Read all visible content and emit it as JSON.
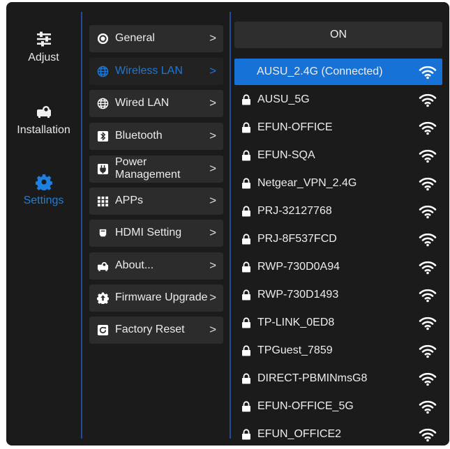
{
  "nav": [
    {
      "label": "Adjust",
      "icon": "sliders-icon"
    },
    {
      "label": "Installation",
      "icon": "projector-icon"
    },
    {
      "label": "Settings",
      "icon": "gear-icon",
      "active": true
    }
  ],
  "menu": [
    {
      "label": "General",
      "icon": "radio-circle-icon"
    },
    {
      "label": "Wireless LAN",
      "icon": "globe-icon",
      "active": true
    },
    {
      "label": "Wired LAN",
      "icon": "globe-icon"
    },
    {
      "label": "Bluetooth",
      "icon": "bluetooth-icon"
    },
    {
      "label": "Power Management",
      "line1": "Power",
      "line2": "Management",
      "icon": "power-plug-icon"
    },
    {
      "label": "APPs",
      "icon": "apps-grid-icon"
    },
    {
      "label": "HDMI Setting",
      "icon": "hdmi-icon"
    },
    {
      "label": "About...",
      "icon": "projector-icon"
    },
    {
      "label": "Firmware Upgrade",
      "icon": "upgrade-icon"
    },
    {
      "label": "Factory Reset",
      "icon": "reset-icon"
    }
  ],
  "chevron": ">",
  "wifi_toggle": "ON",
  "networks": [
    {
      "name": "AUSU_2.4G (Connected)",
      "connected": true,
      "locked": false
    },
    {
      "name": "AUSU_5G",
      "locked": true
    },
    {
      "name": "EFUN-OFFICE",
      "locked": true
    },
    {
      "name": "EFUN-SQA",
      "locked": true
    },
    {
      "name": "Netgear_VPN_2.4G",
      "locked": true
    },
    {
      "name": "PRJ-32127768",
      "locked": true
    },
    {
      "name": "PRJ-8F537FCD",
      "locked": true
    },
    {
      "name": "RWP-730D0A94",
      "locked": true
    },
    {
      "name": "RWP-730D1493",
      "locked": true
    },
    {
      "name": "TP-LINK_0ED8",
      "locked": true
    },
    {
      "name": "TPGuest_7859",
      "locked": true
    },
    {
      "name": "DIRECT-PBMINmsG8",
      "locked": true
    },
    {
      "name": "EFUN-OFFICE_5G",
      "locked": true
    },
    {
      "name": "EFUN_OFFICE2",
      "locked": true
    }
  ],
  "colors": {
    "accent": "#1672d6",
    "background": "#1b1b1b",
    "panel": "#2c2c2c"
  }
}
